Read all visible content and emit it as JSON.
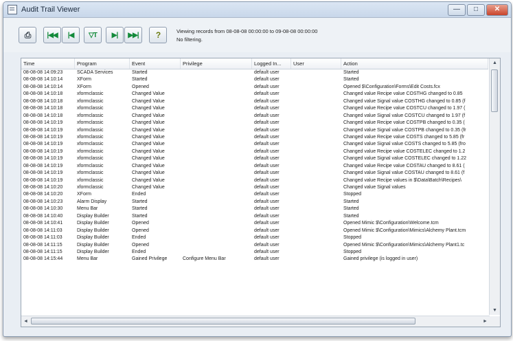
{
  "window": {
    "title": "Audit Trail Viewer"
  },
  "caption": {
    "minimize": "—",
    "maximize": "□",
    "close": "✕"
  },
  "toolbar": {
    "buttons": [
      {
        "icon": "printer-icon",
        "glyph": "⎙"
      },
      {
        "icon": "first-record-icon",
        "glyph": "|◀◀"
      },
      {
        "icon": "previous-record-icon",
        "glyph": "|◀"
      },
      {
        "icon": "filter-icon",
        "glyph": "▽T"
      },
      {
        "icon": "next-record-icon",
        "glyph": "▶|"
      },
      {
        "icon": "last-record-icon",
        "glyph": "▶▶|"
      },
      {
        "icon": "help-icon",
        "glyph": "?"
      }
    ],
    "viewing_text": "Viewing records from 08-08-08 00:00:00 to 09-08-08 00:00:00",
    "filter_text": "No filtering."
  },
  "grid": {
    "columns": [
      "Time",
      "Program",
      "Event",
      "Privilege",
      "Logged In...",
      "User",
      "Action"
    ],
    "rows": [
      [
        "08-08-08 14:09:23",
        "SCADA Services",
        "Started",
        "",
        "default user",
        "",
        "Started"
      ],
      [
        "08-08-08 14:10:14",
        "XForm",
        "Started",
        "",
        "default user",
        "",
        "Started"
      ],
      [
        "08-08-08 14:10:14",
        "XForm",
        "Opened",
        "",
        "default user",
        "",
        "Opened $\\Configuration\\Forms\\Edit Costs.fcx"
      ],
      [
        "08-08-08 14:10:18",
        "xformclassic",
        "Changed Value",
        "",
        "default user",
        "",
        "Changed value Recipe value COSTHG changed to 0.85"
      ],
      [
        "08-08-08 14:10:18",
        "xformclassic",
        "Changed Value",
        "",
        "default user",
        "",
        "Changed value Signal value COSTHG changed to 0.85 (f"
      ],
      [
        "08-08-08 14:10:18",
        "xformclassic",
        "Changed Value",
        "",
        "default user",
        "",
        "Changed value Recipe value COSTCU changed to 1.97 ("
      ],
      [
        "08-08-08 14:10:18",
        "xformclassic",
        "Changed Value",
        "",
        "default user",
        "",
        "Changed value Signal value COSTCU changed to 1.97 (f"
      ],
      [
        "08-08-08 14:10:19",
        "xformclassic",
        "Changed Value",
        "",
        "default user",
        "",
        "Changed value Recipe value COSTPB changed to 0.35 ("
      ],
      [
        "08-08-08 14:10:19",
        "xformclassic",
        "Changed Value",
        "",
        "default user",
        "",
        "Changed value Signal value COSTPB changed to 0.35 (fr"
      ],
      [
        "08-08-08 14:10:19",
        "xformclassic",
        "Changed Value",
        "",
        "default user",
        "",
        "Changed value Recipe value COSTS changed to 5.85 (fr"
      ],
      [
        "08-08-08 14:10:19",
        "xformclassic",
        "Changed Value",
        "",
        "default user",
        "",
        "Changed value Signal value COSTS changed to 5.85 (fro"
      ],
      [
        "08-08-08 14:10:19",
        "xformclassic",
        "Changed Value",
        "",
        "default user",
        "",
        "Changed value Recipe value COSTELEC changed to 1.2"
      ],
      [
        "08-08-08 14:10:19",
        "xformclassic",
        "Changed Value",
        "",
        "default user",
        "",
        "Changed value Signal value COSTELEC changed to 1.22"
      ],
      [
        "08-08-08 14:10:19",
        "xformclassic",
        "Changed Value",
        "",
        "default user",
        "",
        "Changed value Recipe value COSTAU changed to 8.61 ("
      ],
      [
        "08-08-08 14:10:19",
        "xformclassic",
        "Changed Value",
        "",
        "default user",
        "",
        "Changed value Signal value COSTAU changed to 8.61 (f"
      ],
      [
        "08-08-08 14:10:19",
        "xformclassic",
        "Changed Value",
        "",
        "default user",
        "",
        "Changed value Recipe values in $\\Data\\Batch\\Recipes\\"
      ],
      [
        "08-08-08 14:10:20",
        "xformclassic",
        "Changed Value",
        "",
        "default user",
        "",
        "Changed value Signal values"
      ],
      [
        "08-08-08 14:10:20",
        "XForm",
        "Ended",
        "",
        "default user",
        "",
        "Stopped"
      ],
      [
        "08-08-08 14:10:23",
        "Alarm Display",
        "Started",
        "",
        "default user",
        "",
        "Started"
      ],
      [
        "08-08-08 14:10:30",
        "Menu Bar",
        "Started",
        "",
        "default user",
        "",
        "Started"
      ],
      [
        "08-08-08 14:10:40",
        "Display Builder",
        "Started",
        "",
        "default user",
        "",
        "Started"
      ],
      [
        "08-08-08 14:10:41",
        "Display Builder",
        "Opened",
        "",
        "default user",
        "",
        "Opened Mimic $\\Configuration\\Welcome.tcm"
      ],
      [
        "08-08-08 14:11:03",
        "Display Builder",
        "Opened",
        "",
        "default user",
        "",
        "Opened Mimic $\\Configuration\\Mimics\\Alchemy Plant.tcm"
      ],
      [
        "08-08-08 14:11:03",
        "Display Builder",
        "Ended",
        "",
        "default user",
        "",
        "Stopped"
      ],
      [
        "08-08-08 14:11:15",
        "Display Builder",
        "Opened",
        "",
        "default user",
        "",
        "Opened Mimic $\\Configuration\\Mimics\\Alchemy Plant1.tc"
      ],
      [
        "08-08-08 14:11:15",
        "Display Builder",
        "Ended",
        "",
        "default user",
        "",
        "Stopped"
      ],
      [
        "08-08-08 14:15:44",
        "Menu Bar",
        "Gained Privilege",
        "Configure Menu Bar",
        "default user",
        "",
        "Gained privilege (is logged in user)"
      ]
    ]
  },
  "scroll": {
    "up": "▲",
    "down": "▼",
    "left": "◄",
    "right": "►"
  }
}
